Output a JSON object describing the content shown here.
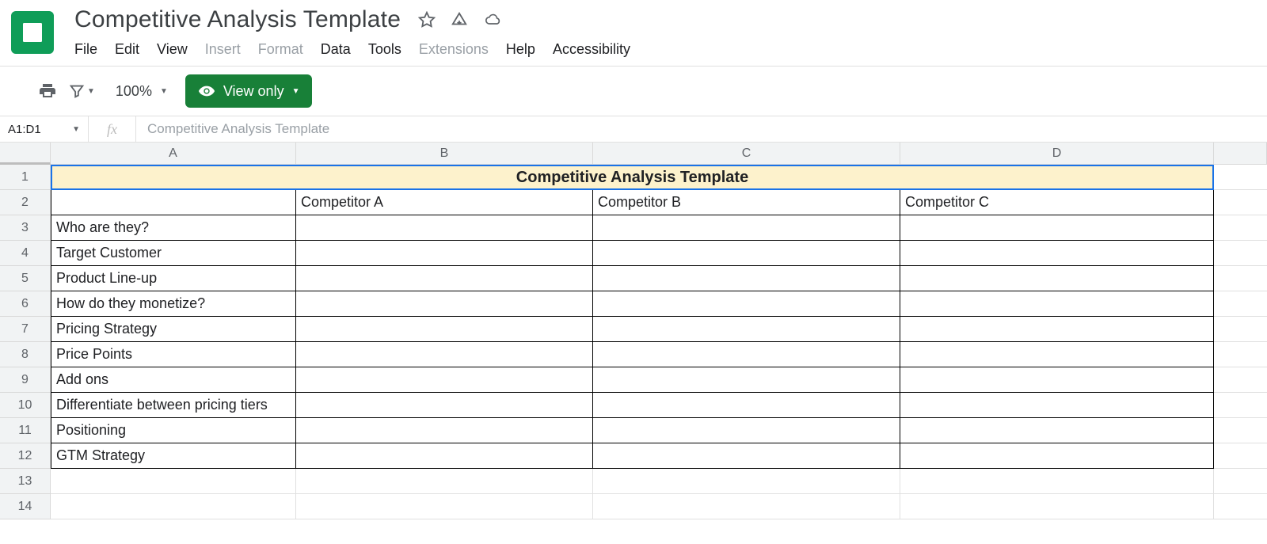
{
  "header": {
    "title": "Competitive Analysis Template",
    "menu": [
      "File",
      "Edit",
      "View",
      "Insert",
      "Format",
      "Data",
      "Tools",
      "Extensions",
      "Help",
      "Accessibility"
    ],
    "disabled_menu": [
      "Insert",
      "Format",
      "Extensions"
    ]
  },
  "toolbar": {
    "zoom": "100%",
    "view_only": "View only"
  },
  "formula_bar": {
    "name_box": "A1:D1",
    "fx": "fx",
    "formula": "Competitive Analysis Template"
  },
  "grid": {
    "col_headers": [
      "A",
      "B",
      "C",
      "D"
    ],
    "row_headers": [
      "1",
      "2",
      "3",
      "4",
      "5",
      "6",
      "7",
      "8",
      "9",
      "10",
      "11",
      "12",
      "13",
      "14"
    ],
    "merged_title": "Competitive Analysis Template",
    "header_row": [
      "",
      "Competitor A",
      "Competitor B",
      "Competitor C"
    ],
    "row_labels": [
      "Who are they?",
      "Target Customer",
      "Product Line-up",
      "How do they monetize?",
      "Pricing Strategy",
      "Price Points",
      "Add ons",
      "Differentiate between pricing tiers",
      "Positioning",
      "GTM Strategy"
    ]
  }
}
